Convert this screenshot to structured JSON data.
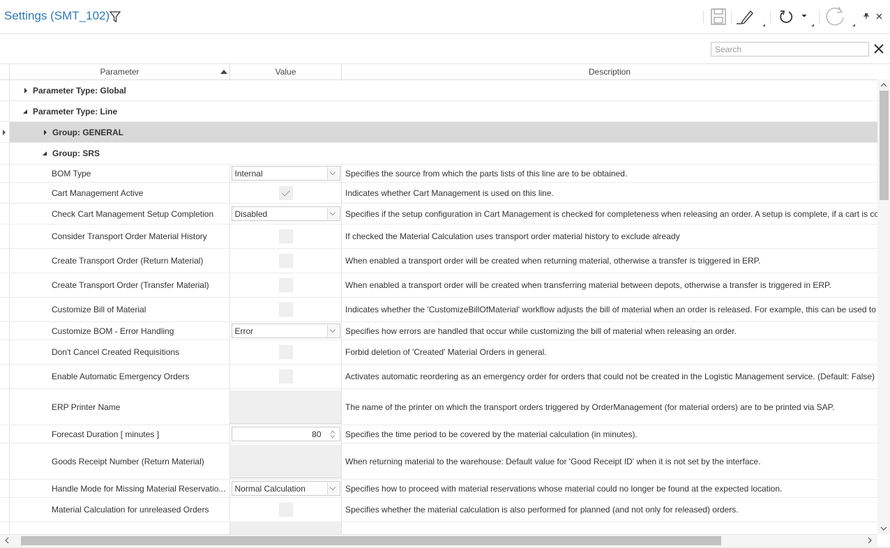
{
  "header": {
    "title": "Settings (SMT_102)"
  },
  "toolbar": {
    "pin_glyph": "ᴖ",
    "close_glyph": "×"
  },
  "search": {
    "placeholder": "Search",
    "close_glyph": "✕"
  },
  "grid": {
    "columns": [
      "Parameter",
      "Value",
      "Description"
    ],
    "groups": {
      "global": "Parameter Type: Global",
      "line": "Parameter Type: Line",
      "general": "Group: GENERAL",
      "srs": "Group: SRS"
    },
    "rows": [
      {
        "param": "BOM Type",
        "value": "Internal",
        "desc": "Specifies the source from which the parts lists of this line are to be obtained."
      },
      {
        "param": "Cart Management Active",
        "value": "",
        "desc": "Indicates whether Cart Management is used on this line."
      },
      {
        "param": "Check Cart Management Setup Completion",
        "value": "Disabled",
        "desc": "Specifies if the setup configuration in Cart Management is checked for completeness when releasing an order. A setup is complete, if a cart is co"
      },
      {
        "param": "Consider Transport Order Material History",
        "value": "",
        "desc": "If checked the Material Calculation uses transport order material history to exclude already"
      },
      {
        "param": "Create Transport Order (Return Material)",
        "value": "",
        "desc": "When enabled a transport order will be created when returning material, otherwise a transfer is triggered in ERP."
      },
      {
        "param": "Create Transport Order (Transfer Material)",
        "value": "",
        "desc": "When enabled a transport order will be created when transferring material between depots, otherwise a transfer is triggered in ERP."
      },
      {
        "param": "Customize Bill of Material",
        "value": "",
        "desc": "Indicates whether the 'CustomizeBillOfMaterial' workflow adjusts the bill of material when an order is released. For example, this can be used to a"
      },
      {
        "param": "Customize BOM - Error Handling",
        "value": "Error",
        "desc": "Specifies how errors are handled that occur while customizing the bill of material when releasing an order."
      },
      {
        "param": "Don't Cancel Created Requisitions",
        "value": "",
        "desc": "Forbid deletion of 'Created' Material Orders in general."
      },
      {
        "param": "Enable Automatic Emergency Orders",
        "value": "",
        "desc": "Activates automatic reordering as an emergency order for orders that could not be created in the Logistic Management service. (Default: False)"
      },
      {
        "param": "ERP Printer Name",
        "value": "",
        "desc": "The name of the printer on which the transport orders triggered by OrderManagement (for material orders) are to be printed via SAP."
      },
      {
        "param": "Forecast Duration [ minutes ]",
        "value": "80",
        "desc": "Specifies the time period to be covered by the material calculation (in minutes)."
      },
      {
        "param": "Goods Receipt Number (Return Material)",
        "value": "",
        "desc": "When returning material to the warehouse: Default value for 'Good Receipt ID' when it is not set by the interface."
      },
      {
        "param": "Handle Mode for Missing Material Reservatio...",
        "value": "Normal Calculation",
        "desc": "Specifies how to proceed with material reservations whose material could no longer be found at the expected location."
      },
      {
        "param": "Material Calculation for unreleased Orders",
        "value": "",
        "desc": "Specifies whether the material calculation is also performed for planned (and not only for released) orders."
      }
    ]
  },
  "scroll": {
    "left_glyph": "<",
    "right_glyph": ">",
    "up_glyph": "^",
    "down_glyph": "v"
  }
}
